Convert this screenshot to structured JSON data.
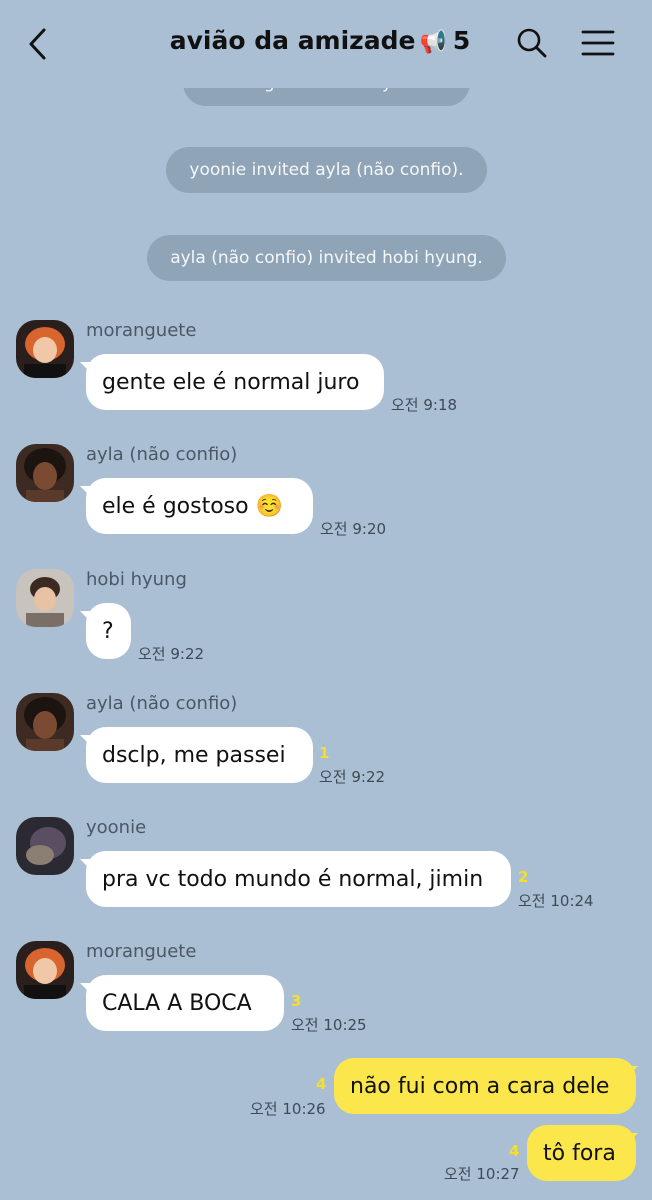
{
  "header": {
    "title": "avião da amizade",
    "title_icon": "📢",
    "member_count": "5"
  },
  "notices": [
    "moranguete  invited yoonie.",
    "yoonie invited ayla (não confio).",
    "ayla (não confio) invited hobi hyung."
  ],
  "messages": [
    {
      "sender": "moranguete",
      "text": "gente ele é normal juro",
      "time": "오전 9:18",
      "unread": ""
    },
    {
      "sender": "ayla (não confio)",
      "text": "ele é gostoso ☺️",
      "time": "오전 9:20",
      "unread": ""
    },
    {
      "sender": "hobi hyung",
      "text": "?",
      "time": "오전 9:22",
      "unread": ""
    },
    {
      "sender": "ayla (não confio)",
      "text": "dsclp, me passei",
      "time": "오전 9:22",
      "unread": "1"
    },
    {
      "sender": "yoonie",
      "text": "pra vc todo mundo é normal, jimin",
      "time": "오전 10:24",
      "unread": "2"
    },
    {
      "sender": "moranguete",
      "text": "CALA A BOCA",
      "time": "오전 10:25",
      "unread": "3"
    }
  ],
  "my_messages": [
    {
      "text": "não fui com a cara dele",
      "time": "오전 10:26",
      "unread": "4"
    },
    {
      "text": "tô fora",
      "time": "오전 10:27",
      "unread": "4"
    }
  ],
  "colors": {
    "background": "#aabfd3",
    "notice_bg": "#8fa4b6",
    "incoming_bubble": "#ffffff",
    "outgoing_bubble": "#fbe64c",
    "unread_count": "#f7de2a"
  }
}
